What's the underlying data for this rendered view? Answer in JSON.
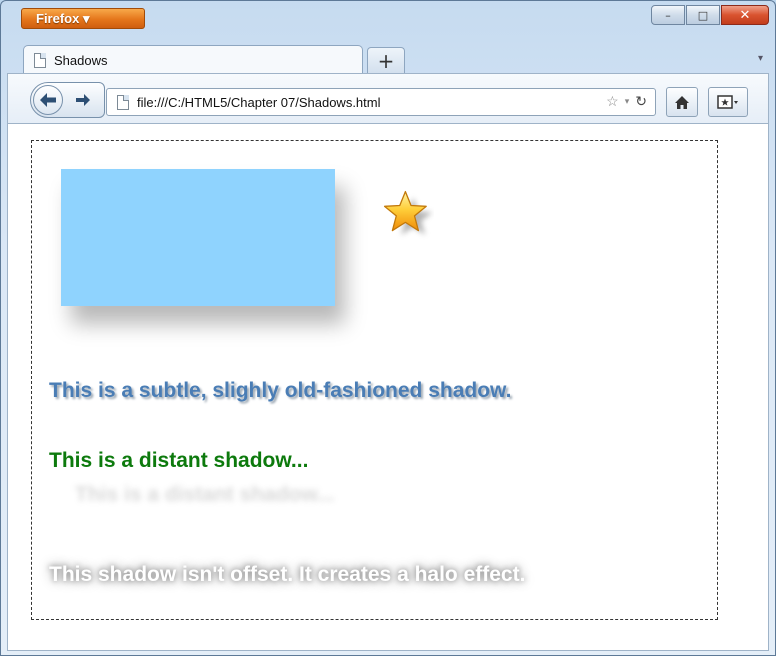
{
  "browser": {
    "menu_button": "Firefox ▾",
    "tab_title": "Shadows",
    "new_tab": "+",
    "url": "file:///C:/HTML5/Chapter 07/Shadows.html",
    "window_controls": {
      "minimize": "–",
      "maximize": "□",
      "close": "✕"
    }
  },
  "page": {
    "line1": "This is a subtle, slighly old-fashioned shadow.",
    "line2": "This is a distant shadow...",
    "line3": "This shadow isn't offset. It creates a halo effect."
  },
  "colors": {
    "box": "#8fd3fe",
    "line1": "#4a7db5",
    "line2": "#0d7a0d",
    "line3": "#ffffff"
  },
  "icons": [
    "star-icon",
    "back-arrow-icon",
    "forward-arrow-icon",
    "bookmark-star-icon",
    "reload-icon",
    "home-icon",
    "bookmarks-icon",
    "page-icon"
  ]
}
